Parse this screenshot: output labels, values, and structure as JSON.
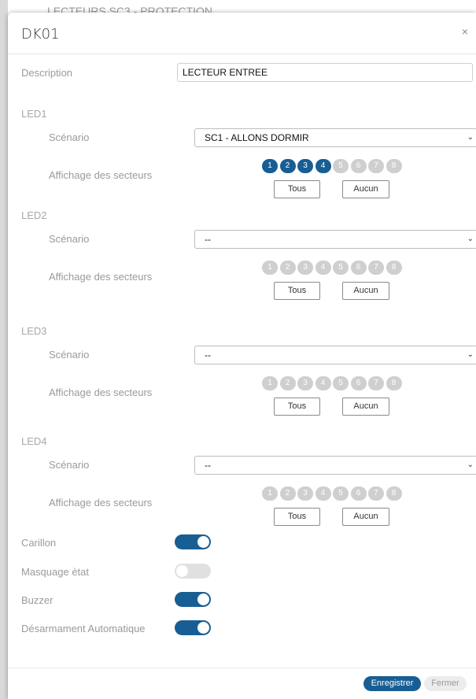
{
  "background": {
    "breadcrumb": "LECTEURS    SC3 - PROTECTION"
  },
  "modal": {
    "title": "DK01",
    "close_icon": "×",
    "description_label": "Description",
    "description_value": "LECTEUR ENTREE"
  },
  "leds": [
    {
      "label": "LED1",
      "scenario_label": "Scénario",
      "scenario_value": "SC1 - ALLONS DORMIR",
      "sectors_label": "Affichage des secteurs",
      "sectors": [
        {
          "n": "1",
          "on": true
        },
        {
          "n": "2",
          "on": true
        },
        {
          "n": "3",
          "on": true
        },
        {
          "n": "4",
          "on": true
        },
        {
          "n": "5",
          "on": false
        },
        {
          "n": "6",
          "on": false
        },
        {
          "n": "7",
          "on": false
        },
        {
          "n": "8",
          "on": false
        }
      ],
      "all_label": "Tous",
      "none_label": "Aucun"
    },
    {
      "label": "LED2",
      "scenario_label": "Scénario",
      "scenario_value": "--",
      "sectors_label": "Affichage des secteurs",
      "sectors": [
        {
          "n": "1",
          "on": false
        },
        {
          "n": "2",
          "on": false
        },
        {
          "n": "3",
          "on": false
        },
        {
          "n": "4",
          "on": false
        },
        {
          "n": "5",
          "on": false
        },
        {
          "n": "6",
          "on": false
        },
        {
          "n": "7",
          "on": false
        },
        {
          "n": "8",
          "on": false
        }
      ],
      "all_label": "Tous",
      "none_label": "Aucun"
    },
    {
      "label": "LED3",
      "scenario_label": "Scénario",
      "scenario_value": "--",
      "sectors_label": "Affichage des secteurs",
      "sectors": [
        {
          "n": "1",
          "on": false
        },
        {
          "n": "2",
          "on": false
        },
        {
          "n": "3",
          "on": false
        },
        {
          "n": "4",
          "on": false
        },
        {
          "n": "5",
          "on": false
        },
        {
          "n": "6",
          "on": false
        },
        {
          "n": "7",
          "on": false
        },
        {
          "n": "8",
          "on": false
        }
      ],
      "all_label": "Tous",
      "none_label": "Aucun"
    },
    {
      "label": "LED4",
      "scenario_label": "Scénario",
      "scenario_value": "--",
      "sectors_label": "Affichage des secteurs",
      "sectors": [
        {
          "n": "1",
          "on": false
        },
        {
          "n": "2",
          "on": false
        },
        {
          "n": "3",
          "on": false
        },
        {
          "n": "4",
          "on": false
        },
        {
          "n": "5",
          "on": false
        },
        {
          "n": "6",
          "on": false
        },
        {
          "n": "7",
          "on": false
        },
        {
          "n": "8",
          "on": false
        }
      ],
      "all_label": "Tous",
      "none_label": "Aucun"
    }
  ],
  "toggles": [
    {
      "label": "Carillon",
      "on": true
    },
    {
      "label": "Masquage ètat",
      "on": false
    },
    {
      "label": "Buzzer",
      "on": true
    },
    {
      "label": "Désarmament Automatique",
      "on": true
    }
  ],
  "footer": {
    "save_label": "Enregistrer",
    "close_label": "Fermer"
  },
  "colors": {
    "accent": "#185e94",
    "inactive": "#cfcfcf"
  }
}
